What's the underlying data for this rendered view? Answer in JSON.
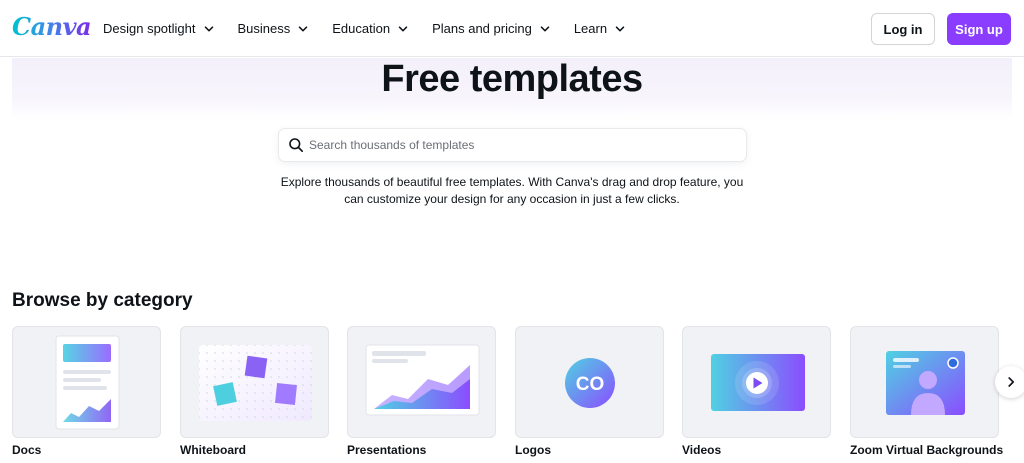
{
  "header": {
    "logo_text": "Canva",
    "nav": [
      {
        "label": "Design spotlight"
      },
      {
        "label": "Business"
      },
      {
        "label": "Education"
      },
      {
        "label": "Plans and pricing"
      },
      {
        "label": "Learn"
      }
    ],
    "login_label": "Log in",
    "signup_label": "Sign up"
  },
  "hero": {
    "title": "Free templates",
    "search_placeholder": "Search thousands of templates",
    "search_value": "",
    "description": "Explore thousands of beautiful free templates. With Canva's drag and drop feature, you can customize your design for any occasion in just a few clicks."
  },
  "browse": {
    "title": "Browse by category",
    "categories": [
      {
        "label": "Docs",
        "icon": "docs-illustration-icon"
      },
      {
        "label": "Whiteboard",
        "icon": "whiteboard-illustration-icon"
      },
      {
        "label": "Presentations",
        "icon": "presentations-illustration-icon"
      },
      {
        "label": "Logos",
        "icon": "logos-illustration-icon",
        "mark": "CO"
      },
      {
        "label": "Videos",
        "icon": "videos-illustration-icon"
      },
      {
        "label": "Zoom Virtual Backgrounds",
        "icon": "zoom-background-illustration-icon"
      }
    ],
    "next_icon": "chevron-right-icon"
  },
  "colors": {
    "brand_purple": "#8b3dff",
    "brand_teal": "#00c4cc",
    "text": "#0e1318"
  }
}
